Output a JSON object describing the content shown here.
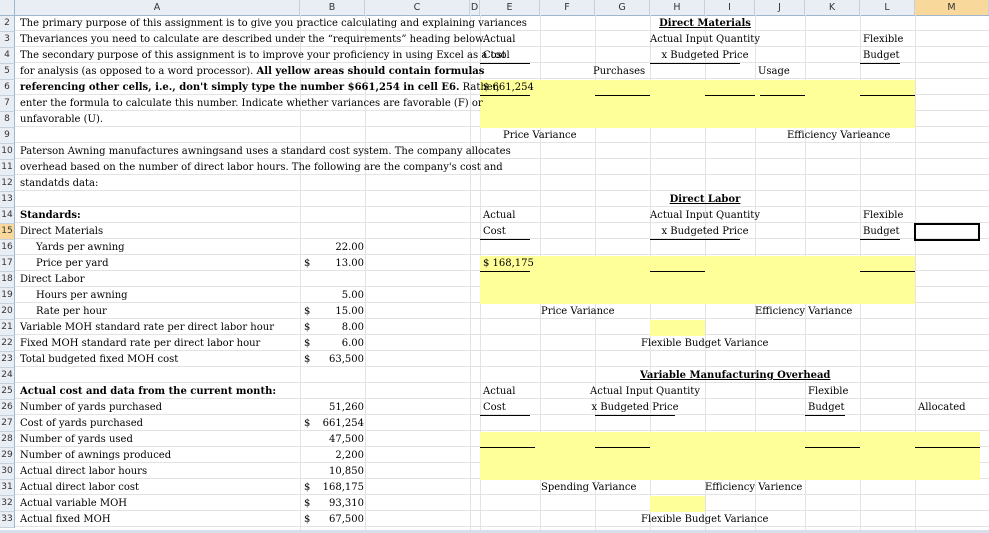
{
  "columns": [
    "A",
    "B",
    "C",
    "D",
    "E",
    "F",
    "G",
    "H",
    "I",
    "J",
    "K",
    "L",
    "M"
  ],
  "rows": [
    "2",
    "3",
    "4",
    "5",
    "6",
    "7",
    "8",
    "9",
    "10",
    "11",
    "12",
    "13",
    "14",
    "15",
    "16",
    "17",
    "18",
    "19",
    "20",
    "21",
    "22",
    "23",
    "24",
    "25",
    "26",
    "27",
    "28",
    "29",
    "30",
    "31",
    "32",
    "33"
  ],
  "instructions": {
    "l1": "The primary purpose of this assignment is to give you practice calculating and explaining variances",
    "l2": "Thevariances you need to calculate are described under the “requirements” heading below.",
    "l3": "The secondary purpose of this assignment is to improve your proficiency in using Excel as a tool",
    "l4a": "for analysis (as opposed to a word processor).  ",
    "l4b": "All yellow areas should contain formulas",
    "l5a": "referencing other cells, i.e., don't simply type the number $661,254 in cell E6.",
    "l5b": "  Rather,",
    "l6": "enter the formula to calculate this number. Indicate whether variances are favorable (F) or",
    "l7": "unfavorable (U)."
  },
  "company": {
    "l1": "Paterson Awning manufactures awningsand uses a standard cost system. The company allocates",
    "l2": "overhead based on the number of direct labor hours. The following are the company's cost and",
    "l3": "standatds data:"
  },
  "standards": {
    "title": "Standards:",
    "dm": "Direct Materials",
    "yards_label": "Yards per awning",
    "yards_value": "22.00",
    "price_label": "Price per yard",
    "price_value": "13.00",
    "dl": "Direct Labor",
    "hours_label": "Hours per awning",
    "hours_value": "5.00",
    "rate_label": "Rate per hour",
    "rate_value": "15.00",
    "vmoh_label": "Variable MOH standard rate per direct labor hour",
    "vmoh_value": "8.00",
    "fmoh_label": "Fixed MOH standard rate per direct labor hour",
    "fmoh_value": "6.00",
    "tfmoh_label": "Total budgeted fixed MOH cost",
    "tfmoh_value": "63,500",
    "dollar": "$"
  },
  "actual": {
    "title": "Actual cost and data from the current month:",
    "yp_label": "Number of yards purchased",
    "yp_value": "51,260",
    "cy_label": "Cost of yards purchased",
    "cy_value": "661,254",
    "yu_label": "Number of yards used",
    "yu_value": "47,500",
    "ap_label": "Number of awnings produced",
    "ap_value": "2,200",
    "dlh_label": "Actual direct labor hours",
    "dlh_value": "10,850",
    "dlc_label": "Actual direct labor cost",
    "dlc_value": "168,175",
    "vmoh_label": "Actual variable MOH",
    "vmoh_value": "93,310",
    "fmoh_label": "Actual fixed MOH",
    "fmoh_value": "67,500"
  },
  "dm_block": {
    "title": "Direct Materials",
    "actual": "Actual",
    "cost": "Cost",
    "aiq": "Actual Input Quantity",
    "xbp": "x Budgeted Price",
    "flexible": "Flexible",
    "budget": "Budget",
    "purchases": "Purchases",
    "usage": "Usage",
    "value": "$ 661,254",
    "price_var": "Price Variance",
    "eff_var": "Efficiency Varieance"
  },
  "dl_block": {
    "title": "Direct Labor",
    "actual": "Actual",
    "cost": "Cost",
    "aiq": "Actual Input Quantity",
    "xbp": "x Budgeted Price",
    "flexible": "Flexible",
    "budget": "Budget",
    "value": "$ 168,175",
    "price_var": "Price Variance",
    "eff_var": "Efficiency Variance",
    "flex_var": "Flexible Budget Variance"
  },
  "vmoh_block": {
    "title": "Variable Manufacturing Overhead",
    "actual": "Actual",
    "cost": "Cost",
    "aiq": "Actual Input Quantity",
    "xbp": "x Budgeted Price",
    "flexible": "Flexible",
    "budget": "Budget",
    "allocated": "Allocated",
    "spend_var": "Spending Variance",
    "eff_var": "Efficiency Varience",
    "flex_var": "Flexible Budget Variance"
  },
  "colors": {
    "highlight": "#ffff99",
    "header_bg": "#e9eef5",
    "selected_header": "#f9d99b"
  }
}
